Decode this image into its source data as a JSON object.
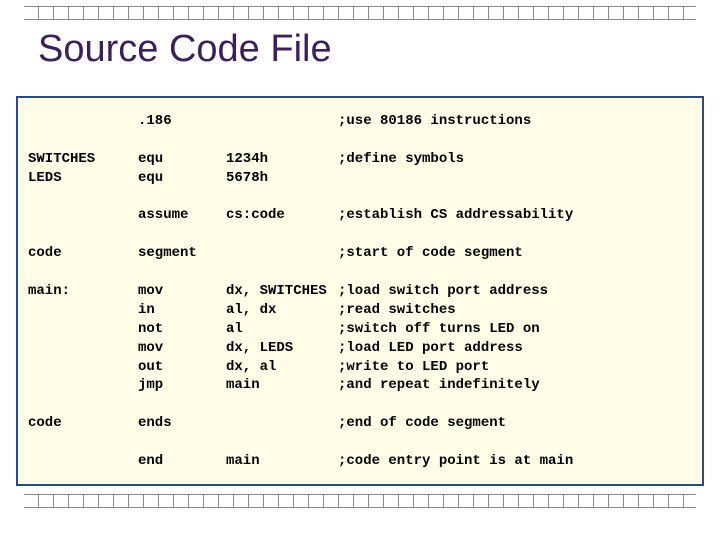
{
  "title": "Source Code File",
  "d": [
    [
      "",
      ".186",
      "",
      ";use 80186 instructions"
    ],
    [
      "",
      "",
      "",
      ""
    ],
    [
      "SWITCHES",
      "equ",
      "1234h",
      ";define symbols"
    ],
    [
      "LEDS",
      "equ",
      "5678h",
      ""
    ],
    [
      "",
      "",
      "",
      ""
    ],
    [
      "",
      "assume",
      "cs:code",
      ";establish CS addressability"
    ],
    [
      "",
      "",
      "",
      ""
    ],
    [
      "code",
      "segment",
      "",
      ";start of code segment"
    ],
    [
      "",
      "",
      "",
      ""
    ],
    [
      "main:",
      "mov",
      "dx, SWITCHES",
      ";load switch port address"
    ],
    [
      "",
      "in",
      "al, dx",
      ";read switches"
    ],
    [
      "",
      "not",
      "al",
      ";switch off turns LED on"
    ],
    [
      "",
      "mov",
      "dx, LEDS",
      ";load LED port address"
    ],
    [
      "",
      "out",
      "dx, al",
      ";write to LED port"
    ],
    [
      "",
      "jmp",
      "main",
      ";and repeat indefinitely"
    ],
    [
      "",
      "",
      "",
      ""
    ],
    [
      "code",
      "ends",
      "",
      ";end of code segment"
    ],
    [
      "",
      "",
      "",
      ""
    ],
    [
      "",
      "end",
      "main",
      ";code entry point is at main"
    ]
  ]
}
